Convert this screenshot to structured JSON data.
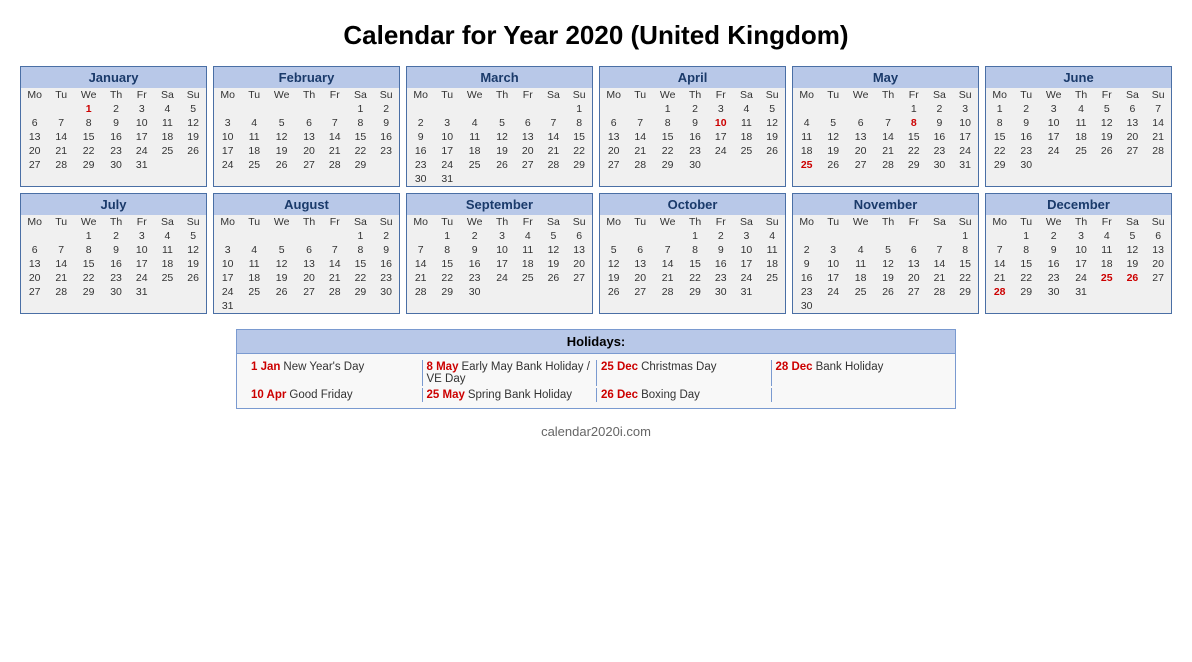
{
  "title": "Calendar for Year 2020 (United Kingdom)",
  "footer": "calendar2020i.com",
  "months": [
    {
      "name": "January",
      "days": [
        "Mo",
        "Tu",
        "We",
        "Th",
        "Fr",
        "Sa",
        "Su"
      ],
      "weeks": [
        [
          "",
          "",
          "1",
          "2",
          "3",
          "4",
          "5"
        ],
        [
          "6",
          "7",
          "8",
          "9",
          "10",
          "11",
          "12"
        ],
        [
          "13",
          "14",
          "15",
          "16",
          "17",
          "18",
          "19"
        ],
        [
          "20",
          "21",
          "22",
          "23",
          "24",
          "25",
          "26"
        ],
        [
          "27",
          "28",
          "29",
          "30",
          "31",
          "",
          ""
        ]
      ],
      "red": [
        "1"
      ]
    },
    {
      "name": "February",
      "days": [
        "Mo",
        "Tu",
        "We",
        "Th",
        "Fr",
        "Sa",
        "Su"
      ],
      "weeks": [
        [
          "",
          "",
          "",
          "",
          "",
          "1",
          "2"
        ],
        [
          "3",
          "4",
          "5",
          "6",
          "7",
          "8",
          "9"
        ],
        [
          "10",
          "11",
          "12",
          "13",
          "14",
          "15",
          "16"
        ],
        [
          "17",
          "18",
          "19",
          "20",
          "21",
          "22",
          "23"
        ],
        [
          "24",
          "25",
          "26",
          "27",
          "28",
          "29",
          ""
        ]
      ],
      "red": []
    },
    {
      "name": "March",
      "days": [
        "Mo",
        "Tu",
        "We",
        "Th",
        "Fr",
        "Sa",
        "Su"
      ],
      "weeks": [
        [
          "",
          "",
          "",
          "",
          "",
          "",
          "1"
        ],
        [
          "2",
          "3",
          "4",
          "5",
          "6",
          "7",
          "8"
        ],
        [
          "9",
          "10",
          "11",
          "12",
          "13",
          "14",
          "15"
        ],
        [
          "16",
          "17",
          "18",
          "19",
          "20",
          "21",
          "22"
        ],
        [
          "23",
          "24",
          "25",
          "26",
          "27",
          "28",
          "29"
        ],
        [
          "30",
          "31",
          "",
          "",
          "",
          "",
          ""
        ]
      ],
      "red": []
    },
    {
      "name": "April",
      "days": [
        "Mo",
        "Tu",
        "We",
        "Th",
        "Fr",
        "Sa",
        "Su"
      ],
      "weeks": [
        [
          "",
          "",
          "1",
          "2",
          "3",
          "4",
          "5"
        ],
        [
          "6",
          "7",
          "8",
          "9",
          "10",
          "11",
          "12"
        ],
        [
          "13",
          "14",
          "15",
          "16",
          "17",
          "18",
          "19"
        ],
        [
          "20",
          "21",
          "22",
          "23",
          "24",
          "25",
          "26"
        ],
        [
          "27",
          "28",
          "29",
          "30",
          "",
          "",
          ""
        ]
      ],
      "red": [
        "10"
      ]
    },
    {
      "name": "May",
      "days": [
        "Mo",
        "Tu",
        "We",
        "Th",
        "Fr",
        "Sa",
        "Su"
      ],
      "weeks": [
        [
          "",
          "",
          "",
          "",
          "1",
          "2",
          "3"
        ],
        [
          "4",
          "5",
          "6",
          "7",
          "8",
          "9",
          "10"
        ],
        [
          "11",
          "12",
          "13",
          "14",
          "15",
          "16",
          "17"
        ],
        [
          "18",
          "19",
          "20",
          "21",
          "22",
          "23",
          "24"
        ],
        [
          "25",
          "26",
          "27",
          "28",
          "29",
          "30",
          "31"
        ]
      ],
      "red": [
        "8",
        "25"
      ]
    },
    {
      "name": "June",
      "days": [
        "Mo",
        "Tu",
        "We",
        "Th",
        "Fr",
        "Sa",
        "Su"
      ],
      "weeks": [
        [
          "1",
          "2",
          "3",
          "4",
          "5",
          "6",
          "7"
        ],
        [
          "8",
          "9",
          "10",
          "11",
          "12",
          "13",
          "14"
        ],
        [
          "15",
          "16",
          "17",
          "18",
          "19",
          "20",
          "21"
        ],
        [
          "22",
          "23",
          "24",
          "25",
          "26",
          "27",
          "28"
        ],
        [
          "29",
          "30",
          "",
          "",
          "",
          "",
          ""
        ]
      ],
      "red": []
    },
    {
      "name": "July",
      "days": [
        "Mo",
        "Tu",
        "We",
        "Th",
        "Fr",
        "Sa",
        "Su"
      ],
      "weeks": [
        [
          "",
          "",
          "1",
          "2",
          "3",
          "4",
          "5"
        ],
        [
          "6",
          "7",
          "8",
          "9",
          "10",
          "11",
          "12"
        ],
        [
          "13",
          "14",
          "15",
          "16",
          "17",
          "18",
          "19"
        ],
        [
          "20",
          "21",
          "22",
          "23",
          "24",
          "25",
          "26"
        ],
        [
          "27",
          "28",
          "29",
          "30",
          "31",
          "",
          ""
        ]
      ],
      "red": []
    },
    {
      "name": "August",
      "days": [
        "Mo",
        "Tu",
        "We",
        "Th",
        "Fr",
        "Sa",
        "Su"
      ],
      "weeks": [
        [
          "",
          "",
          "",
          "",
          "",
          "1",
          "2"
        ],
        [
          "3",
          "4",
          "5",
          "6",
          "7",
          "8",
          "9"
        ],
        [
          "10",
          "11",
          "12",
          "13",
          "14",
          "15",
          "16"
        ],
        [
          "17",
          "18",
          "19",
          "20",
          "21",
          "22",
          "23"
        ],
        [
          "24",
          "25",
          "26",
          "27",
          "28",
          "29",
          "30"
        ],
        [
          "31",
          "",
          "",
          "",
          "",
          "",
          ""
        ]
      ],
      "red": []
    },
    {
      "name": "September",
      "days": [
        "Mo",
        "Tu",
        "We",
        "Th",
        "Fr",
        "Sa",
        "Su"
      ],
      "weeks": [
        [
          "",
          "1",
          "2",
          "3",
          "4",
          "5",
          "6"
        ],
        [
          "7",
          "8",
          "9",
          "10",
          "11",
          "12",
          "13"
        ],
        [
          "14",
          "15",
          "16",
          "17",
          "18",
          "19",
          "20"
        ],
        [
          "21",
          "22",
          "23",
          "24",
          "25",
          "26",
          "27"
        ],
        [
          "28",
          "29",
          "30",
          "",
          "",
          "",
          ""
        ]
      ],
      "red": []
    },
    {
      "name": "October",
      "days": [
        "Mo",
        "Tu",
        "We",
        "Th",
        "Fr",
        "Sa",
        "Su"
      ],
      "weeks": [
        [
          "",
          "",
          "",
          "1",
          "2",
          "3",
          "4"
        ],
        [
          "5",
          "6",
          "7",
          "8",
          "9",
          "10",
          "11"
        ],
        [
          "12",
          "13",
          "14",
          "15",
          "16",
          "17",
          "18"
        ],
        [
          "19",
          "20",
          "21",
          "22",
          "23",
          "24",
          "25"
        ],
        [
          "26",
          "27",
          "28",
          "29",
          "30",
          "31",
          ""
        ]
      ],
      "red": []
    },
    {
      "name": "November",
      "days": [
        "Mo",
        "Tu",
        "We",
        "Th",
        "Fr",
        "Sa",
        "Su"
      ],
      "weeks": [
        [
          "",
          "",
          "",
          "",
          "",
          "",
          "1"
        ],
        [
          "2",
          "3",
          "4",
          "5",
          "6",
          "7",
          "8"
        ],
        [
          "9",
          "10",
          "11",
          "12",
          "13",
          "14",
          "15"
        ],
        [
          "16",
          "17",
          "18",
          "19",
          "20",
          "21",
          "22"
        ],
        [
          "23",
          "24",
          "25",
          "26",
          "27",
          "28",
          "29"
        ],
        [
          "30",
          "",
          "",
          "",
          "",
          "",
          ""
        ]
      ],
      "red": []
    },
    {
      "name": "December",
      "days": [
        "Mo",
        "Tu",
        "We",
        "Th",
        "Fr",
        "Sa",
        "Su"
      ],
      "weeks": [
        [
          "",
          "1",
          "2",
          "3",
          "4",
          "5",
          "6"
        ],
        [
          "7",
          "8",
          "9",
          "10",
          "11",
          "12",
          "13"
        ],
        [
          "14",
          "15",
          "16",
          "17",
          "18",
          "19",
          "20"
        ],
        [
          "21",
          "22",
          "23",
          "24",
          "25",
          "26",
          "27"
        ],
        [
          "28",
          "29",
          "30",
          "31",
          "",
          "",
          ""
        ]
      ],
      "red": [
        "25",
        "26",
        "28"
      ]
    }
  ],
  "holidays_title": "Holidays:",
  "holidays": [
    {
      "date": "1 Jan",
      "name": "New Year's Day"
    },
    {
      "date": "8 May",
      "name": "Early May Bank Holiday / VE Day"
    },
    {
      "date": "25 Dec",
      "name": "Christmas Day"
    },
    {
      "date": "28 Dec",
      "name": "Bank Holiday"
    },
    {
      "date": "10 Apr",
      "name": "Good Friday"
    },
    {
      "date": "25 May",
      "name": "Spring Bank Holiday"
    },
    {
      "date": "26 Dec",
      "name": "Boxing Day"
    },
    {
      "date": "",
      "name": ""
    }
  ]
}
